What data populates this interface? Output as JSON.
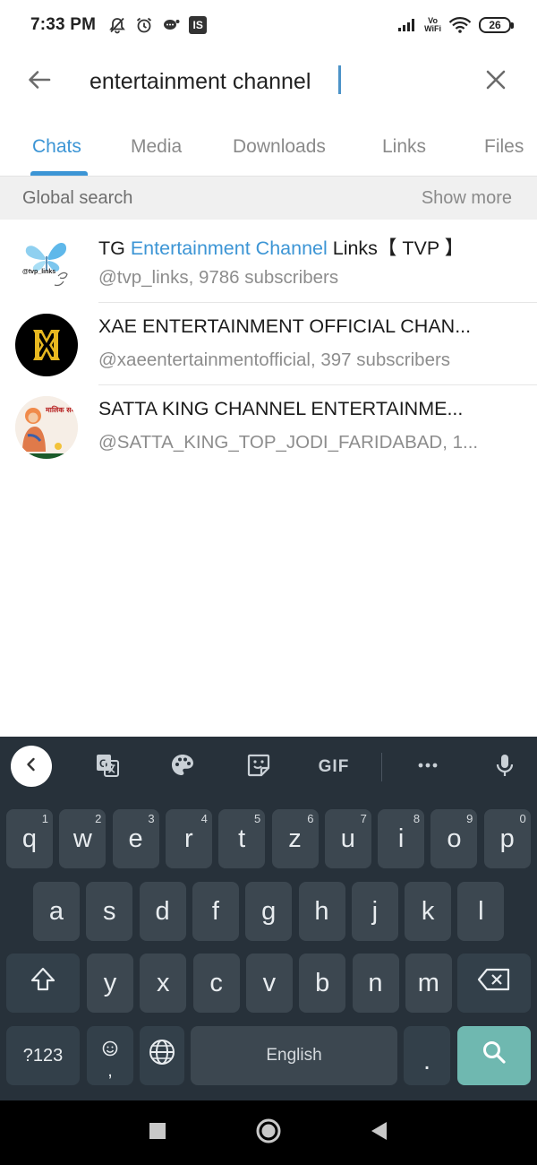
{
  "status_bar": {
    "time": "7:33 PM",
    "left_icons": [
      "mute-icon",
      "alarm-icon",
      "chat-bubble-icon",
      "is-app-icon"
    ],
    "is_badge": "IS",
    "vowifi_top": "Vo",
    "vowifi_bottom": "WiFi",
    "battery": "26"
  },
  "search": {
    "query": "entertainment channel",
    "back_icon": "arrow-left-icon",
    "clear_icon": "close-icon"
  },
  "tabs": [
    {
      "label": "Chats",
      "active": true
    },
    {
      "label": "Media",
      "active": false
    },
    {
      "label": "Downloads",
      "active": false
    },
    {
      "label": "Links",
      "active": false
    },
    {
      "label": "Files",
      "active": false
    }
  ],
  "global_search": {
    "title": "Global search",
    "more": "Show more"
  },
  "results": [
    {
      "title_prefix": "TG ",
      "title_highlight": "Entertainment Channel",
      "title_suffix": " Links【 TVP 】",
      "subtitle": "@tvp_links, 9786 subscribers",
      "avatar_text": "@tvp_links"
    },
    {
      "title_prefix": "",
      "title_highlight": "",
      "title_suffix": "XAE ENTERTAINMENT OFFICIAL CHAN...",
      "subtitle": "@xaeentertainmentofficial, 397 subscribers",
      "avatar_text": ""
    },
    {
      "title_prefix": "",
      "title_highlight": "",
      "title_suffix": "SATTA KING CHANNEL ENTERTAINME...",
      "subtitle": "@SATTA_KING_TOP_JODI_FARIDABAD, 1...",
      "avatar_text": "मालिक सबको खुश रखे"
    }
  ],
  "keyboard": {
    "toolbar": {
      "gif": "GIF",
      "icons": [
        "chevron-left-icon",
        "translate-icon",
        "palette-icon",
        "sticker-icon",
        "gif-icon",
        "more-icon",
        "microphone-icon"
      ]
    },
    "row1": [
      {
        "k": "q",
        "h": "1"
      },
      {
        "k": "w",
        "h": "2"
      },
      {
        "k": "e",
        "h": "3"
      },
      {
        "k": "r",
        "h": "4"
      },
      {
        "k": "t",
        "h": "5"
      },
      {
        "k": "z",
        "h": "6"
      },
      {
        "k": "u",
        "h": "7"
      },
      {
        "k": "i",
        "h": "8"
      },
      {
        "k": "o",
        "h": "9"
      },
      {
        "k": "p",
        "h": "0"
      }
    ],
    "row2": [
      "a",
      "s",
      "d",
      "f",
      "g",
      "h",
      "j",
      "k",
      "l"
    ],
    "row3": [
      "y",
      "x",
      "c",
      "v",
      "b",
      "n",
      "m"
    ],
    "symbols": "?123",
    "comma": ",",
    "space": "English",
    "period": ".",
    "accent": "#6fb8b0"
  },
  "nav": {
    "icons": [
      "recents-square-icon",
      "home-circle-icon",
      "back-triangle-icon"
    ]
  }
}
